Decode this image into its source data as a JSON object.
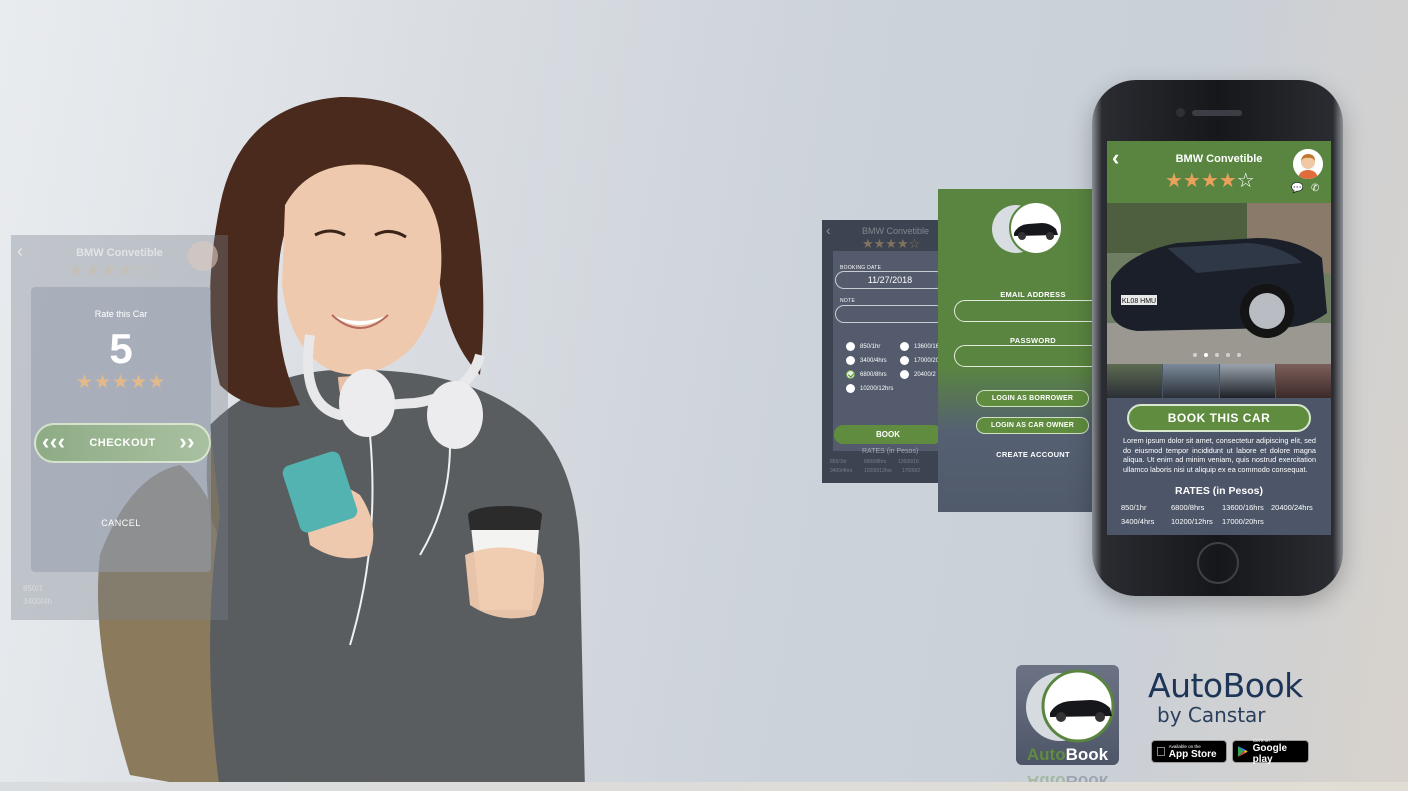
{
  "rate_screen": {
    "header_title": "BMW Convetible",
    "header_stars": "★★★★☆",
    "card_title": "Rate this Car",
    "rating_value": "5",
    "rating_stars": "★★★★★",
    "checkout_label": "CHECKOUT",
    "cancel_label": "CANCEL",
    "ghost_rate_1": "850/1",
    "ghost_rate_2": "3400/4h"
  },
  "booking_screen": {
    "header_title": "BMW Convetible",
    "header_stars": "★★★★☆",
    "booking_date_label": "BOOKING DATE",
    "booking_date_value": "11/27/2018",
    "note_label": "NOTE",
    "note_value": "",
    "options_col1": [
      "850/1hr",
      "3400/4hrs",
      "6800/8hrs",
      "10200/12hrs"
    ],
    "options_col2": [
      "13600/16",
      "17000/20",
      "20400/2"
    ],
    "selected_option": "6800/8hrs",
    "book_label": "BOOK",
    "rates_label": "RATES (in Pesos)",
    "ghost_rows": [
      "850/1hr",
      "6800/8hrs",
      "13600/16",
      "3400/4hrs",
      "10200/12hrs",
      "17000/2"
    ]
  },
  "login_screen": {
    "email_label": "EMAIL ADDRESS",
    "email_value": "",
    "password_label": "PASSWORD",
    "password_value": "",
    "login_borrower_label": "LOGIN AS BORROWER",
    "login_owner_label": "LOGIN AS CAR OWNER",
    "create_account_label": "CREATE ACCOUNT"
  },
  "car_detail": {
    "title": "BMW Convetible",
    "rating_filled": 4,
    "rating_total": 5,
    "stars_on": "★★★★",
    "stars_off": "☆",
    "chat_icon": "chat-icon",
    "call_icon": "phone-icon",
    "license_plate": "KL08 HMU",
    "carousel_active_index": 1,
    "carousel_count": 5,
    "book_button_label": "BOOK THIS CAR",
    "description": "Lorem ipsum dolor sit amet, consectetur adipiscing elit, sed do eiusmod tempor incididunt ut labore et dolore magna aliqua. Ut enim ad minim veniam, quis nostrud exercitation ullamco laboris nisi ut aliquip ex ea commodo consequat.",
    "rates_title": "RATES (in Pesos)",
    "rates_row1": [
      "850/1hr",
      "6800/8hrs",
      "13600/16hrs",
      "20400/24hrs"
    ],
    "rates_row2": [
      "3400/4hrs",
      "10200/12hrs",
      "17000/20hrs"
    ]
  },
  "brand": {
    "app_name": "AutoBook",
    "by_line": "by Canstar",
    "icon_word_auto": "Auto",
    "icon_word_book": "Book",
    "app_store_small": "Available on the",
    "app_store_big": "App Store",
    "google_small": "Get it on",
    "google_big": "Google play"
  },
  "colors": {
    "brand_green": "#5a8540",
    "button_green": "#5f8c3e",
    "slate": "#4d5568",
    "star_orange": "#e8a25c",
    "brand_navy": "#1d3556"
  }
}
